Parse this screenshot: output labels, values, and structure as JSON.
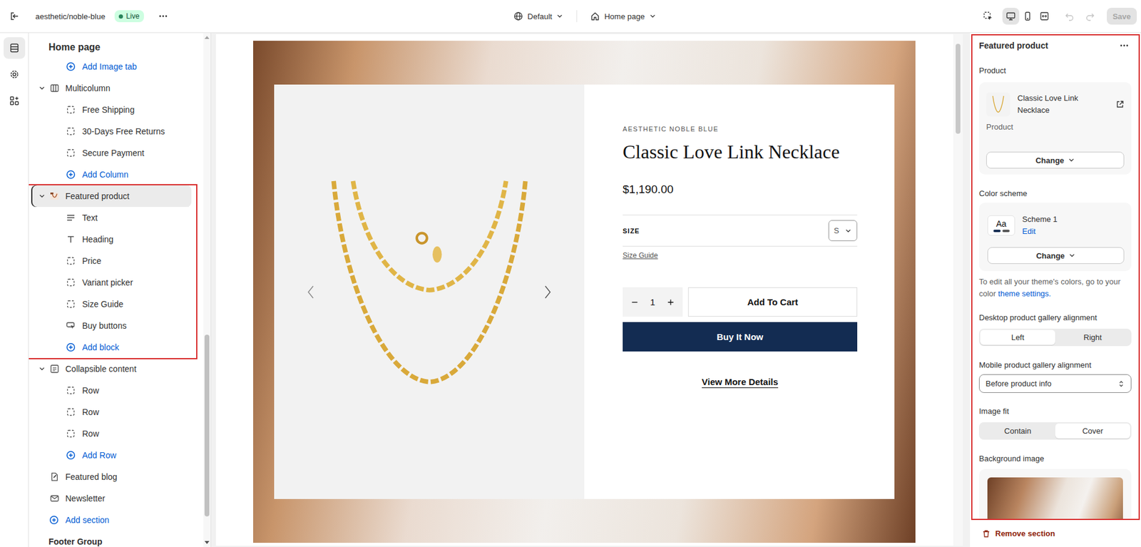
{
  "topbar": {
    "store": "aesthetic/noble-blue",
    "status": "Live",
    "theme": "Default",
    "page": "Home page",
    "views": [
      {
        "kind": "desktop",
        "selected": true
      },
      {
        "kind": "mobile",
        "selected": false
      },
      {
        "kind": "fullwidth",
        "selected": false
      }
    ],
    "undo": {
      "disabled": true
    },
    "redo": {
      "disabled": true
    },
    "save": {
      "label": "Save",
      "disabled": true
    }
  },
  "rail": [
    {
      "kind": "sections",
      "selected": true
    },
    {
      "kind": "settings",
      "selected": false
    },
    {
      "kind": "apps",
      "selected": false
    }
  ],
  "sidebar": {
    "title": "Home page",
    "groups": [
      {
        "section": null,
        "children": [
          {
            "label": "Add Image tab",
            "kind": "add"
          }
        ]
      },
      {
        "section": {
          "label": "Multicolumn",
          "kind": "multicolumn",
          "expanded": true,
          "selected": false
        },
        "children": [
          {
            "label": "Free Shipping",
            "kind": "block"
          },
          {
            "label": "30-Days Free Returns",
            "kind": "block"
          },
          {
            "label": "Secure Payment",
            "kind": "block"
          },
          {
            "label": "Add Column",
            "kind": "add"
          }
        ]
      },
      {
        "section": {
          "label": "Featured product",
          "kind": "product",
          "expanded": true,
          "selected": true
        },
        "children": [
          {
            "label": "Text",
            "kind": "text"
          },
          {
            "label": "Heading",
            "kind": "heading"
          },
          {
            "label": "Price",
            "kind": "block"
          },
          {
            "label": "Variant picker",
            "kind": "block"
          },
          {
            "label": "Size Guide",
            "kind": "block"
          },
          {
            "label": "Buy buttons",
            "kind": "buttons"
          },
          {
            "label": "Add block",
            "kind": "add"
          }
        ]
      },
      {
        "section": {
          "label": "Collapsible content",
          "kind": "collapsible",
          "expanded": true,
          "selected": false
        },
        "children": [
          {
            "label": "Row",
            "kind": "block"
          },
          {
            "label": "Row",
            "kind": "block"
          },
          {
            "label": "Row",
            "kind": "block"
          },
          {
            "label": "Add Row",
            "kind": "add"
          }
        ]
      },
      {
        "section": {
          "label": "Featured blog",
          "kind": "blog",
          "expanded": false,
          "selected": false
        },
        "children": []
      },
      {
        "section": {
          "label": "Newsletter",
          "kind": "newsletter",
          "expanded": false,
          "selected": false
        },
        "children": []
      }
    ],
    "add_section": "Add section",
    "footer_group": "Footer Group"
  },
  "preview": {
    "product": {
      "vendor": "AESTHETIC NOBLE BLUE",
      "title": "Classic Love Link Necklace",
      "price": "$1,190.00",
      "option": {
        "label": "SIZE",
        "value": "S"
      },
      "size_guide": "Size Guide",
      "quantity": "1",
      "add_to_cart": "Add To Cart",
      "buy_now": "Buy It Now",
      "details": "View More Details"
    }
  },
  "settings": {
    "title": "Featured product",
    "product": {
      "label": "Product",
      "name": "Classic Love Link Necklace",
      "type": "Product",
      "change": "Change"
    },
    "color_scheme": {
      "label": "Color scheme",
      "swatch": "Aa",
      "name": "Scheme 1",
      "edit": "Edit",
      "change": "Change"
    },
    "help": {
      "text": "To edit all your theme's colors, go to your color ",
      "link": "theme settings."
    },
    "desktop_alignment": {
      "label": "Desktop product gallery alignment",
      "options": [
        {
          "label": "Left",
          "selected": true
        },
        {
          "label": "Right",
          "selected": false
        }
      ]
    },
    "mobile_alignment": {
      "label": "Mobile product gallery alignment",
      "value": "Before product info"
    },
    "image_fit": {
      "label": "Image fit",
      "options": [
        {
          "label": "Contain",
          "selected": false
        },
        {
          "label": "Cover",
          "selected": true
        }
      ]
    },
    "background_image": {
      "label": "Background image"
    },
    "remove": "Remove section"
  }
}
